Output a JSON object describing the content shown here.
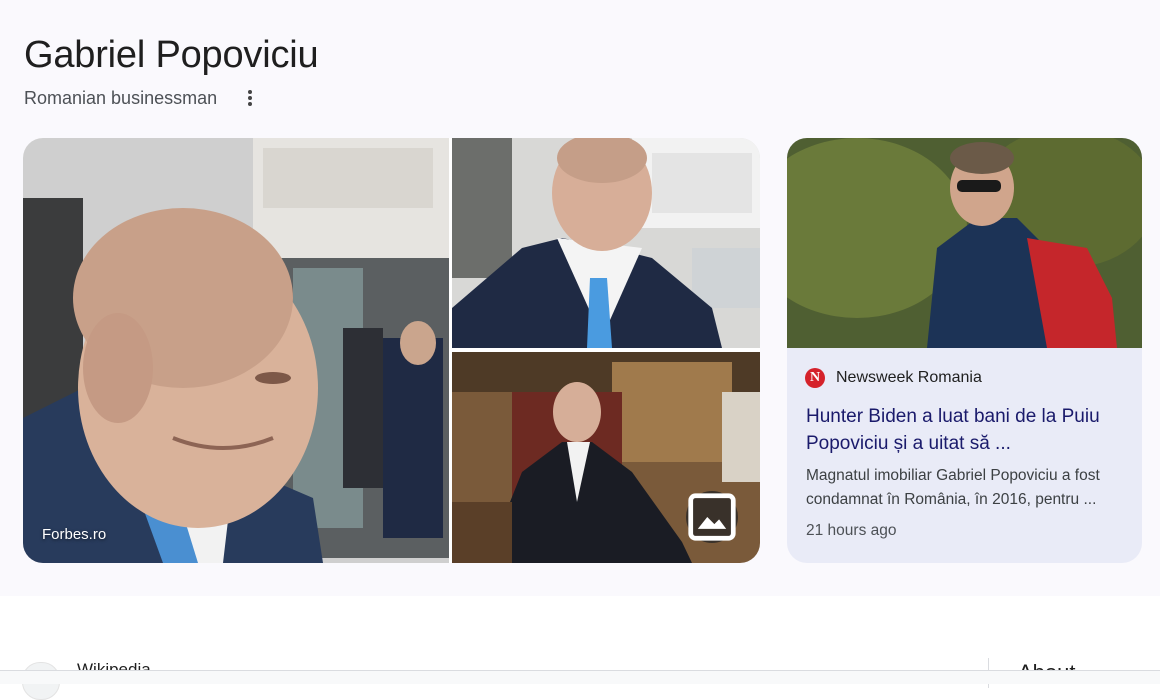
{
  "entity": {
    "title": "Gabriel Popoviciu",
    "subtitle": "Romanian businessman"
  },
  "gallery": {
    "source_label": "Forbes.ro",
    "view_images_icon": "image-icon",
    "more_icon": "more-vert-icon"
  },
  "news": {
    "publisher": "Newsweek Romania",
    "publisher_logo_letter": "N",
    "headline": "Hunter Biden a luat bani de la Puiu Popoviciu și a uitat să ...",
    "snippet": "Magnatul imobiliar Gabriel Popoviciu a fost condamnat în România, în 2016, pentru ...",
    "time": "21 hours ago"
  },
  "bottom": {
    "wikipedia_label": "Wikipedia",
    "about_label": "About"
  },
  "colors": {
    "panel_bg": "#faf9fd",
    "news_card_bg": "#e9ebf7",
    "headline_color": "#1a1a6b",
    "publisher_logo_red": "#d5222b"
  }
}
